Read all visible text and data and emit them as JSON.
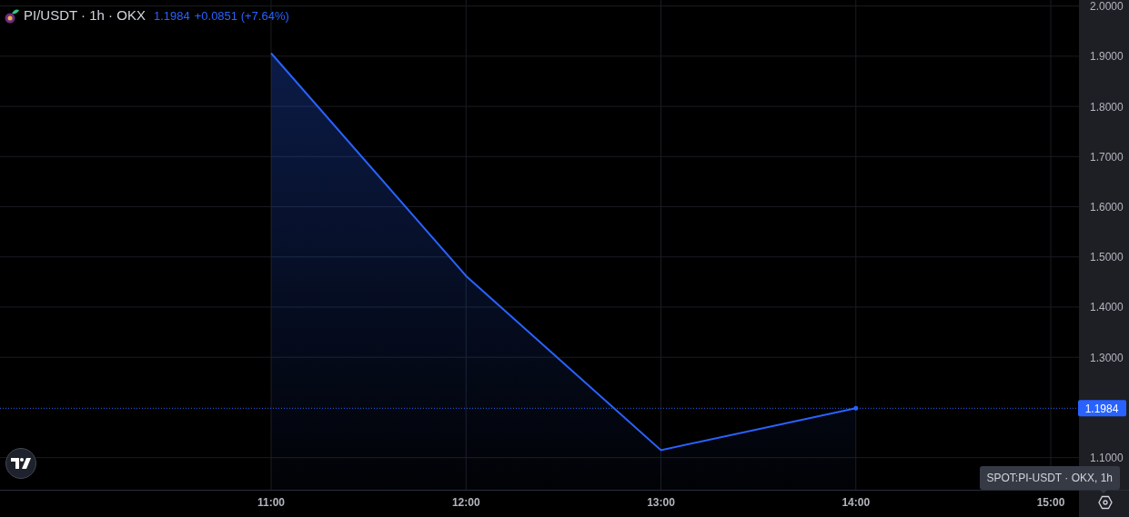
{
  "header": {
    "symbol": "PI/USDT · 1h · OKX",
    "price": "1.1984",
    "change": "+0.0851 (+7.64%)"
  },
  "chart": {
    "chart_data": {
      "type": "area",
      "grid": true,
      "categories": [
        "11:00",
        "12:00",
        "13:00",
        "14:00",
        "15:00"
      ],
      "series": [
        {
          "color": "#2962ff",
          "values": [
            1.906,
            1.462,
            1.115,
            1.1984,
            null
          ]
        }
      ],
      "ref_lines": [
        {
          "axis": "y",
          "value": 1.1984,
          "color": "#2962ff"
        }
      ],
      "ylim": [
        1.036,
        2.012
      ],
      "yticks": [
        {
          "value": 1.1,
          "label": "1.1000"
        },
        {
          "value": 1.3,
          "label": "1.3000"
        },
        {
          "value": 1.4,
          "label": "1.4000"
        },
        {
          "value": 1.5,
          "label": "1.5000"
        },
        {
          "value": 1.6,
          "label": "1.6000"
        },
        {
          "value": 1.7,
          "label": "1.7000"
        },
        {
          "value": 1.8,
          "label": "1.8000"
        },
        {
          "value": 1.9,
          "label": "1.9000"
        },
        {
          "value": 2.0,
          "label": "2.0000"
        }
      ]
    }
  },
  "last_price_label": "1.1984",
  "tooltip": "SPOT:PI-USDT · OKX, 1h"
}
